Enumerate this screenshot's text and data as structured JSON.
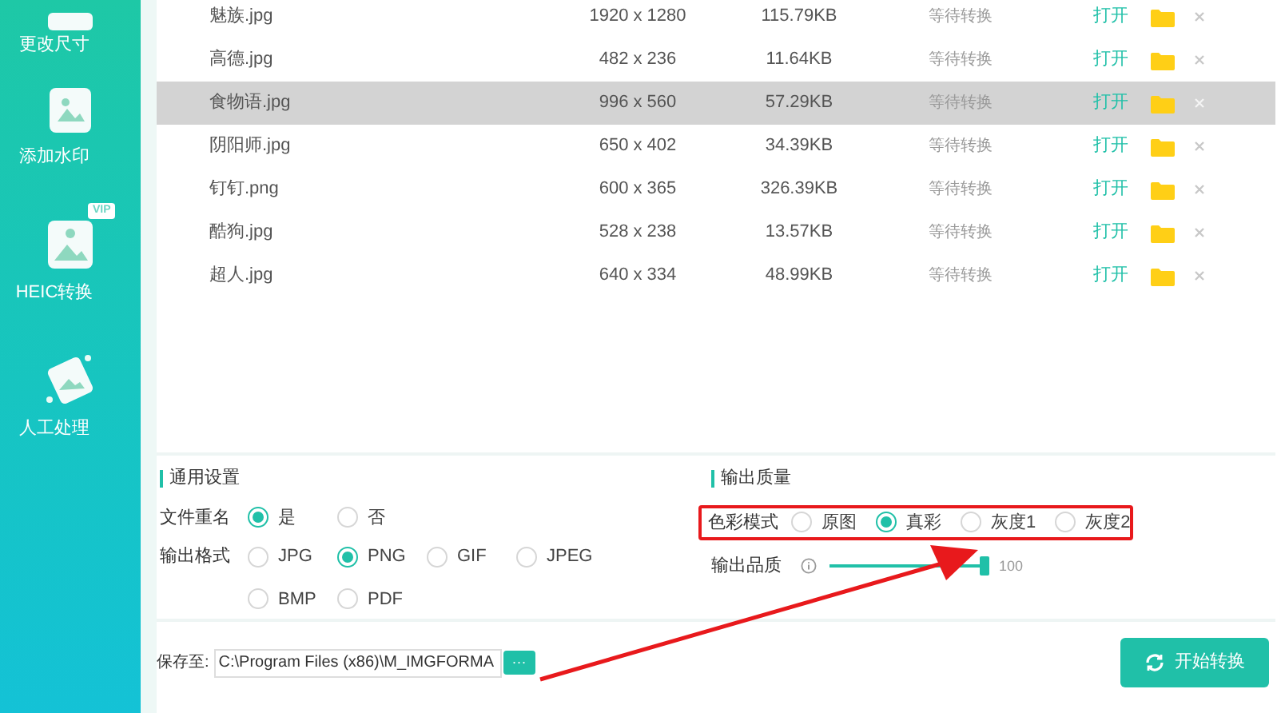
{
  "sidebar": {
    "items": [
      {
        "label": "更改尺寸",
        "kind": "resize",
        "vip": false
      },
      {
        "label": "添加水印",
        "kind": "watermark",
        "vip": false
      },
      {
        "label": "HEIC转换",
        "kind": "heic",
        "vip": true
      },
      {
        "label": "人工处理",
        "kind": "manual",
        "vip": false
      }
    ],
    "vip_badge": "VIP"
  },
  "files": [
    {
      "name": "魅族.jpg",
      "dimensions": "1920 x 1280",
      "size": "115.79KB",
      "status": "等待转换",
      "open": "打开",
      "selected": false
    },
    {
      "name": "高德.jpg",
      "dimensions": "482 x 236",
      "size": "11.64KB",
      "status": "等待转换",
      "open": "打开",
      "selected": false
    },
    {
      "name": "食物语.jpg",
      "dimensions": "996 x 560",
      "size": "57.29KB",
      "status": "等待转换",
      "open": "打开",
      "selected": true
    },
    {
      "name": "阴阳师.jpg",
      "dimensions": "650 x 402",
      "size": "34.39KB",
      "status": "等待转换",
      "open": "打开",
      "selected": false
    },
    {
      "name": "钉钉.png",
      "dimensions": "600 x 365",
      "size": "326.39KB",
      "status": "等待转换",
      "open": "打开",
      "selected": false
    },
    {
      "name": "酷狗.jpg",
      "dimensions": "528 x 238",
      "size": "13.57KB",
      "status": "等待转换",
      "open": "打开",
      "selected": false
    },
    {
      "name": "超人.jpg",
      "dimensions": "640 x 334",
      "size": "48.99KB",
      "status": "等待转换",
      "open": "打开",
      "selected": false
    }
  ],
  "general_settings": {
    "title": "通用设置",
    "rename": {
      "label": "文件重名",
      "options": [
        {
          "label": "是",
          "selected": true
        },
        {
          "label": "否",
          "selected": false
        }
      ]
    },
    "format": {
      "label": "输出格式",
      "options": [
        {
          "label": "JPG",
          "selected": false
        },
        {
          "label": "PNG",
          "selected": true
        },
        {
          "label": "GIF",
          "selected": false
        },
        {
          "label": "JPEG",
          "selected": false
        },
        {
          "label": "BMP",
          "selected": false
        },
        {
          "label": "PDF",
          "selected": false
        }
      ]
    }
  },
  "output_quality": {
    "title": "输出质量",
    "color_mode": {
      "label": "色彩模式",
      "options": [
        {
          "label": "原图",
          "selected": false
        },
        {
          "label": "真彩",
          "selected": true
        },
        {
          "label": "灰度1",
          "selected": false
        },
        {
          "label": "灰度2",
          "selected": false
        }
      ]
    },
    "quality": {
      "label": "输出品质",
      "level": 1,
      "reading": "100"
    }
  },
  "save": {
    "label": "保存至:",
    "value": "C:\\Program Files (x86)\\M_IMGFORMA",
    "browse": "···"
  },
  "start_button": {
    "label": "开始转换"
  }
}
